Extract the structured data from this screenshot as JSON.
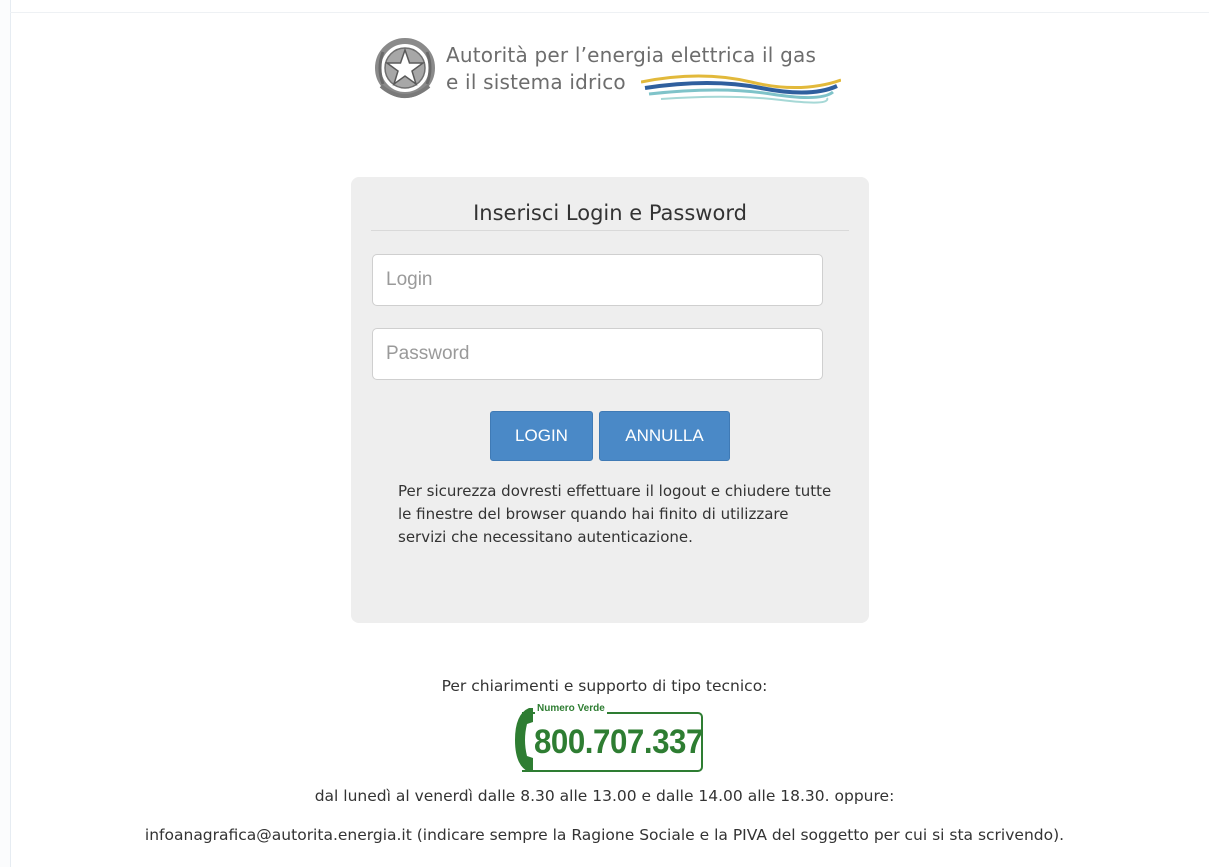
{
  "header": {
    "org_line1": "Autorità per l’energia elettrica il gas",
    "org_line2": "e il sistema idrico"
  },
  "login": {
    "title": "Inserisci Login e Password",
    "login_placeholder": "Login",
    "login_value": "",
    "password_placeholder": "Password",
    "password_value": "",
    "login_button": "LOGIN",
    "cancel_button": "ANNULLA",
    "notice": "Per sicurezza dovresti effettuare il logout e chiudere tutte le finestre del browser quando hai finito di utilizzare servizi che necessitano autenticazione."
  },
  "support": {
    "title": "Per chiarimenti e supporto di tipo tecnico:",
    "badge_label": "Numero Verde",
    "phone": "800.707.337",
    "hours": "dal lunedì al venerdì dalle 8.30 alle 13.00 e dalle 14.00 alle 18.30. oppure:",
    "email_info": "infoanagrafica@autorita.energia.it (indicare sempre la Ragione Sociale e la PIVA del soggetto per cui si sta scrivendo)."
  },
  "colors": {
    "button": "#4a89c7",
    "panel": "#eeeeee",
    "numero_verde": "#2e7d32",
    "wave_blue": "#2f5f9e",
    "wave_yellow": "#e2b93b",
    "wave_teal": "#7fc3c9"
  },
  "icons": {
    "emblem": "italian-republic-emblem-icon",
    "phone": "phone-handset-icon"
  }
}
